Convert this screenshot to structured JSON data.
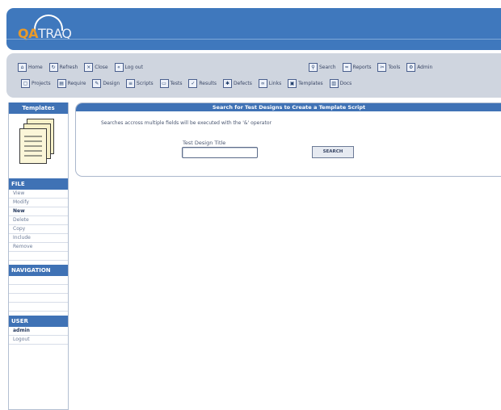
{
  "app": {
    "logo_accent": "QA",
    "logo_rest": "TRAQ"
  },
  "toolbar": {
    "row1_left": [
      {
        "label": "Home",
        "icon": "home-icon"
      },
      {
        "label": "Refresh",
        "icon": "refresh-icon"
      },
      {
        "label": "Close",
        "icon": "close-icon"
      },
      {
        "label": "Log out",
        "icon": "logout-icon"
      }
    ],
    "row1_right": [
      {
        "label": "Search",
        "icon": "search-icon"
      },
      {
        "label": "Reports",
        "icon": "reports-icon"
      },
      {
        "label": "Tools",
        "icon": "tools-icon"
      },
      {
        "label": "Admin",
        "icon": "admin-icon"
      }
    ],
    "row2": [
      {
        "label": "Projects",
        "icon": "projects-icon"
      },
      {
        "label": "Require",
        "icon": "requirements-icon"
      },
      {
        "label": "Design",
        "icon": "design-icon"
      },
      {
        "label": "Scripts",
        "icon": "scripts-icon"
      },
      {
        "label": "Tests",
        "icon": "tests-icon"
      },
      {
        "label": "Results",
        "icon": "results-icon"
      },
      {
        "label": "Defects",
        "icon": "defects-icon"
      },
      {
        "label": "Links",
        "icon": "links-icon"
      },
      {
        "label": "Templates",
        "icon": "templates-icon"
      },
      {
        "label": "Docs",
        "icon": "docs-icon"
      }
    ]
  },
  "sidebar": {
    "templates_title": "Templates",
    "file_title": "FILE",
    "file_items": [
      "View",
      "Modify",
      "New",
      "Delete",
      "Copy",
      "Include",
      "Remove"
    ],
    "file_active": "New",
    "navigation_title": "NAVIGATION",
    "user_title": "USER",
    "user_name": "admin",
    "logout": "Logout"
  },
  "main": {
    "title": "Search for Test Designs to Create a Template Script",
    "note": "Searches accross multiple fields will be executed with the '&' operator",
    "field_label": "Test Design Title",
    "field_value": "",
    "search_button": "SEARCH"
  },
  "colors": {
    "header_blue": "#3f78bd",
    "accent_orange": "#e89a2b",
    "menubar_grey": "#cfd5df",
    "section_blue": "#3f72b5"
  }
}
